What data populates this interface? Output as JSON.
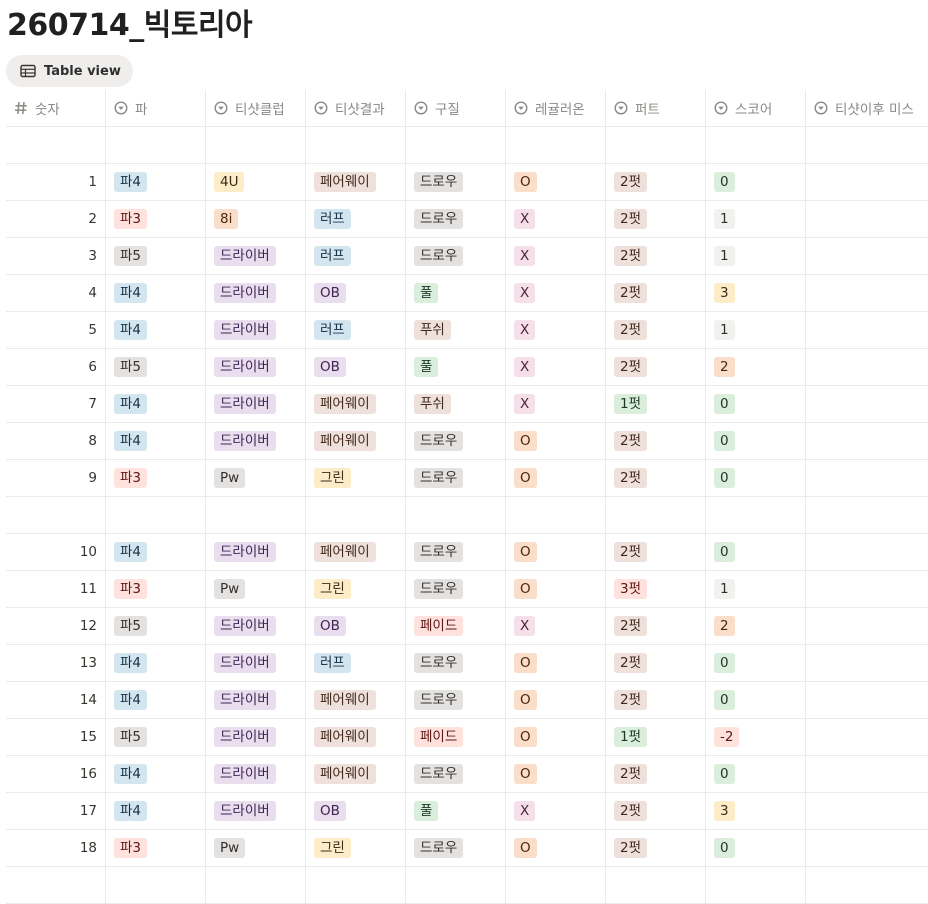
{
  "page": {
    "title": "260714_빅토리아"
  },
  "view": {
    "label": "Table view"
  },
  "columns": [
    "숫자",
    "파",
    "티샷클럽",
    "티샷결과",
    "구질",
    "레귤러온",
    "퍼트",
    "스코어",
    "티샷이후 미스"
  ],
  "colors": {
    "blue": "#d3e5ef",
    "red": "#ffe2dd",
    "gray": "#e3e2e0",
    "yellow": "#fdecc8",
    "orange": "#fadec9",
    "purple": "#e8deee",
    "pink": "#f5e0e9",
    "brown": "#eee0da",
    "green": "#dbeddb",
    "light_gray": "#f1f1ef"
  },
  "rows": [
    {
      "n": "",
      "par": "",
      "club": "",
      "result": "",
      "shape": "",
      "gir": "",
      "putt": "",
      "score": "",
      "miss": ""
    },
    {
      "n": "1",
      "par": "파4",
      "club": "4U",
      "result": "페어웨이",
      "shape": "드로우",
      "gir": "O",
      "putt": "2펏",
      "score": "0",
      "miss": ""
    },
    {
      "n": "2",
      "par": "파3",
      "club": "8i",
      "result": "러프",
      "shape": "드로우",
      "gir": "X",
      "putt": "2펏",
      "score": "1",
      "miss": ""
    },
    {
      "n": "3",
      "par": "파5",
      "club": "드라이버",
      "result": "러프",
      "shape": "드로우",
      "gir": "X",
      "putt": "2펏",
      "score": "1",
      "miss": ""
    },
    {
      "n": "4",
      "par": "파4",
      "club": "드라이버",
      "result": "OB",
      "shape": "풀",
      "gir": "X",
      "putt": "2펏",
      "score": "3",
      "miss": ""
    },
    {
      "n": "5",
      "par": "파4",
      "club": "드라이버",
      "result": "러프",
      "shape": "푸쉬",
      "gir": "X",
      "putt": "2펏",
      "score": "1",
      "miss": ""
    },
    {
      "n": "6",
      "par": "파5",
      "club": "드라이버",
      "result": "OB",
      "shape": "풀",
      "gir": "X",
      "putt": "2펏",
      "score": "2",
      "miss": ""
    },
    {
      "n": "7",
      "par": "파4",
      "club": "드라이버",
      "result": "페어웨이",
      "shape": "푸쉬",
      "gir": "X",
      "putt": "1펏",
      "score": "0",
      "miss": ""
    },
    {
      "n": "8",
      "par": "파4",
      "club": "드라이버",
      "result": "페어웨이",
      "shape": "드로우",
      "gir": "O",
      "putt": "2펏",
      "score": "0",
      "miss": ""
    },
    {
      "n": "9",
      "par": "파3",
      "club": "Pw",
      "result": "그린",
      "shape": "드로우",
      "gir": "O",
      "putt": "2펏",
      "score": "0",
      "miss": ""
    },
    {
      "n": "",
      "par": "",
      "club": "",
      "result": "",
      "shape": "",
      "gir": "",
      "putt": "",
      "score": "",
      "miss": ""
    },
    {
      "n": "10",
      "par": "파4",
      "club": "드라이버",
      "result": "페어웨이",
      "shape": "드로우",
      "gir": "O",
      "putt": "2펏",
      "score": "0",
      "miss": ""
    },
    {
      "n": "11",
      "par": "파3",
      "club": "Pw",
      "result": "그린",
      "shape": "드로우",
      "gir": "O",
      "putt": "3펏",
      "score": "1",
      "miss": ""
    },
    {
      "n": "12",
      "par": "파5",
      "club": "드라이버",
      "result": "OB",
      "shape": "페이드",
      "gir": "X",
      "putt": "2펏",
      "score": "2",
      "miss": ""
    },
    {
      "n": "13",
      "par": "파4",
      "club": "드라이버",
      "result": "러프",
      "shape": "드로우",
      "gir": "O",
      "putt": "2펏",
      "score": "0",
      "miss": ""
    },
    {
      "n": "14",
      "par": "파4",
      "club": "드라이버",
      "result": "페어웨이",
      "shape": "드로우",
      "gir": "O",
      "putt": "2펏",
      "score": "0",
      "miss": ""
    },
    {
      "n": "15",
      "par": "파5",
      "club": "드라이버",
      "result": "페어웨이",
      "shape": "페이드",
      "gir": "O",
      "putt": "1펏",
      "score": "-2",
      "miss": ""
    },
    {
      "n": "16",
      "par": "파4",
      "club": "드라이버",
      "result": "페어웨이",
      "shape": "드로우",
      "gir": "O",
      "putt": "2펏",
      "score": "0",
      "miss": ""
    },
    {
      "n": "17",
      "par": "파4",
      "club": "드라이버",
      "result": "OB",
      "shape": "풀",
      "gir": "X",
      "putt": "2펏",
      "score": "3",
      "miss": ""
    },
    {
      "n": "18",
      "par": "파3",
      "club": "Pw",
      "result": "그린",
      "shape": "드로우",
      "gir": "O",
      "putt": "2펏",
      "score": "0",
      "miss": ""
    },
    {
      "n": "",
      "par": "",
      "club": "",
      "result": "",
      "shape": "",
      "gir": "",
      "putt": "",
      "score": "",
      "miss": ""
    }
  ]
}
